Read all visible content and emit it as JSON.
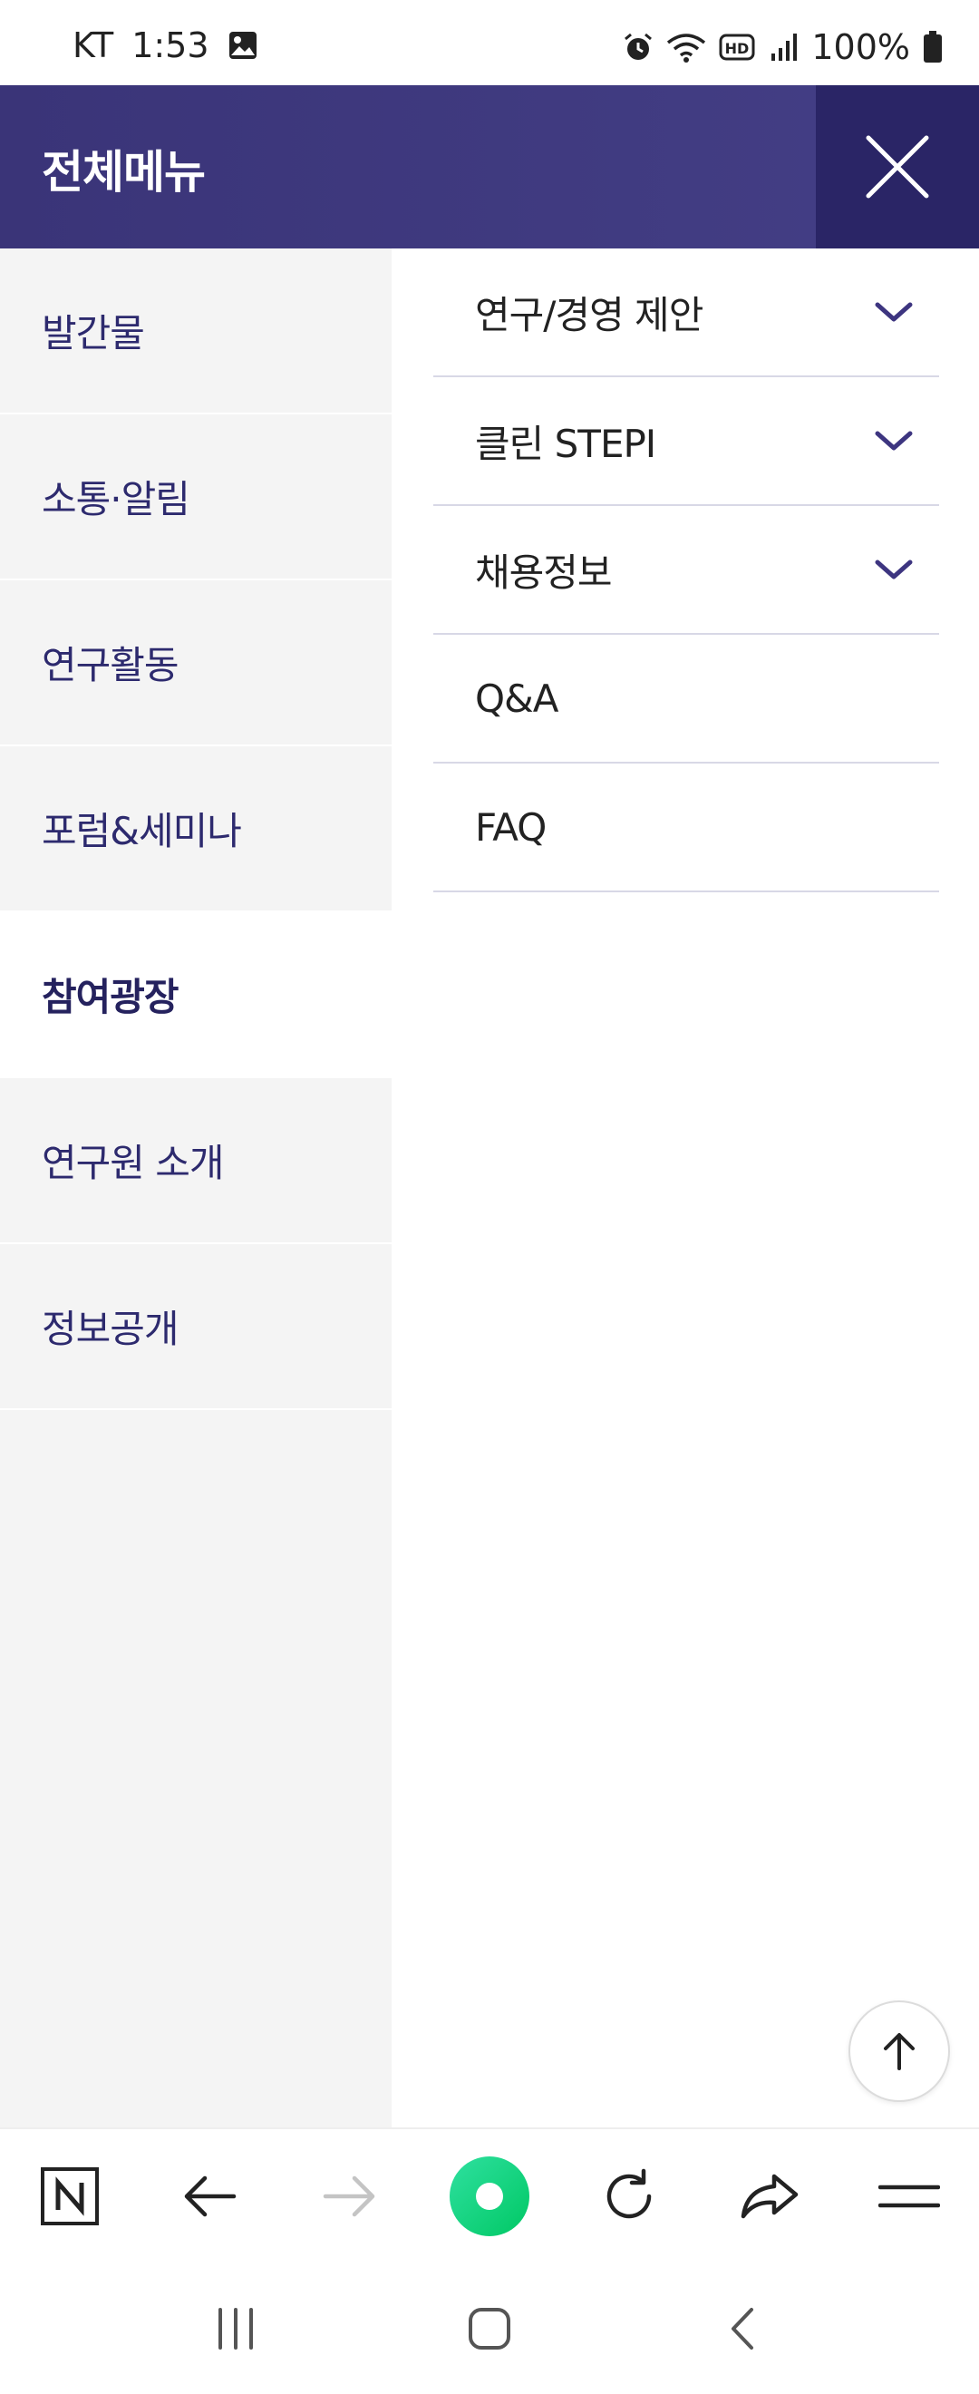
{
  "status_bar": {
    "carrier": "KT",
    "time": "1:53",
    "battery": "100%"
  },
  "header": {
    "title": "전체메뉴"
  },
  "left_menu": {
    "items": [
      {
        "label": "발간물"
      },
      {
        "label": "소통·알림"
      },
      {
        "label": "연구활동"
      },
      {
        "label": "포럼&세미나"
      },
      {
        "label": "참여광장",
        "active": true
      },
      {
        "label": "연구원 소개"
      },
      {
        "label": "정보공개"
      }
    ]
  },
  "sub_menu": {
    "items": [
      {
        "label": "연구/경영 제안",
        "expandable": true
      },
      {
        "label": "클린 STEPI",
        "expandable": true
      },
      {
        "label": "채용정보",
        "expandable": true
      },
      {
        "label": "Q&A",
        "expandable": false
      },
      {
        "label": "FAQ",
        "expandable": false
      }
    ]
  },
  "colors": {
    "header_bg": "#3f3a80",
    "close_bg": "#2a2566",
    "accent_text": "#2d2a6e",
    "chevron": "#3d3580",
    "browser_home": "#00d26a"
  },
  "toolbar": {
    "icons": [
      "naver-n-icon",
      "back-arrow-icon",
      "forward-arrow-icon",
      "home-circle-icon",
      "refresh-icon",
      "share-icon",
      "menu-icon"
    ]
  },
  "system_nav": {
    "icons": [
      "recent-apps-icon",
      "home-icon",
      "back-icon"
    ]
  }
}
